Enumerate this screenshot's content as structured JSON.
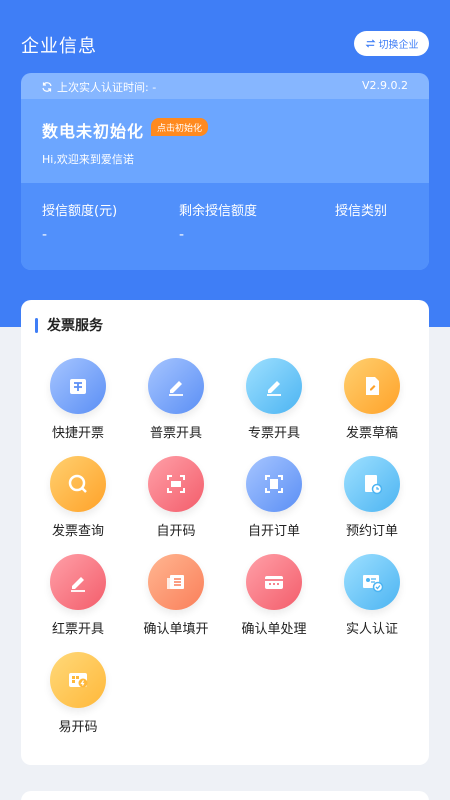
{
  "header": {
    "title": "企业信息",
    "switch_label": "切换企业"
  },
  "info_card": {
    "auth_text": "上次实人认证时间: -",
    "version": "V2.9.0.2",
    "name": "数电未初始化",
    "badge": "点击初始化",
    "welcome": "Hi,欢迎来到爱信诺",
    "credit": [
      {
        "label": "授信额度(元)",
        "value": "-"
      },
      {
        "label": "剩余授信额度",
        "value": "-"
      },
      {
        "label": "授信类别",
        "value": ""
      }
    ]
  },
  "services": {
    "title": "发票服务",
    "items": [
      {
        "label": "快捷开票",
        "icon": "quick-invoice-icon",
        "color": "blue"
      },
      {
        "label": "普票开具",
        "icon": "pen-icon",
        "color": "blue"
      },
      {
        "label": "专票开具",
        "icon": "pen-icon",
        "color": "cyan"
      },
      {
        "label": "发票草稿",
        "icon": "draft-doc-icon",
        "color": "orange"
      },
      {
        "label": "发票查询",
        "icon": "search-icon",
        "color": "orange"
      },
      {
        "label": "自开码",
        "icon": "scan-icon",
        "color": "red"
      },
      {
        "label": "自开订单",
        "icon": "scan-doc-icon",
        "color": "blue"
      },
      {
        "label": "预约订单",
        "icon": "clock-doc-icon",
        "color": "cyan"
      },
      {
        "label": "红票开具",
        "icon": "pen-icon",
        "color": "red"
      },
      {
        "label": "确认单填开",
        "icon": "form-icon",
        "color": "salmon"
      },
      {
        "label": "确认单处理",
        "icon": "card-icon",
        "color": "red"
      },
      {
        "label": "实人认证",
        "icon": "id-verify-icon",
        "color": "cyan"
      },
      {
        "label": "易开码",
        "icon": "qr-bolt-icon",
        "color": "yellow"
      }
    ]
  }
}
